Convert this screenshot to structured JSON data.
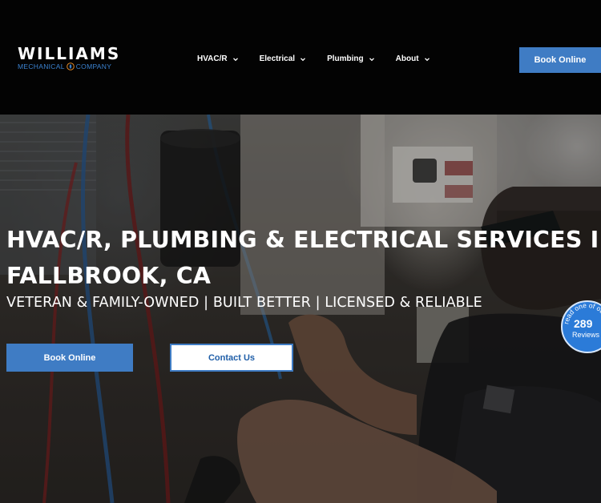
{
  "header": {
    "logo": {
      "name": "WILLIAMS",
      "tagline_left": "MECHANICAL",
      "tagline_right": "COMPANY"
    },
    "nav": [
      {
        "label": "HVAC/R"
      },
      {
        "label": "Electrical"
      },
      {
        "label": "Plumbing"
      },
      {
        "label": "About"
      }
    ],
    "book_label": "Book Online"
  },
  "hero": {
    "title_line1": "HVAC/R, PLUMBING & ELECTRICAL SERVICES IN",
    "title_line2": "FALLBROOK, CA",
    "subtitle": "VETERAN & FAMILY-OWNED | BUILT BETTER | LICENSED & RELIABLE",
    "book_label": "Book Online",
    "contact_label": "Contact Us",
    "review_badge": {
      "count": "289",
      "label": "Reviews",
      "ring_text": "read one of our reviews"
    }
  },
  "colors": {
    "accent": "#3f7cc4",
    "header_bg": "#030303",
    "logo_blue": "#3b82d0",
    "badge_blue": "#2b7bd8"
  }
}
